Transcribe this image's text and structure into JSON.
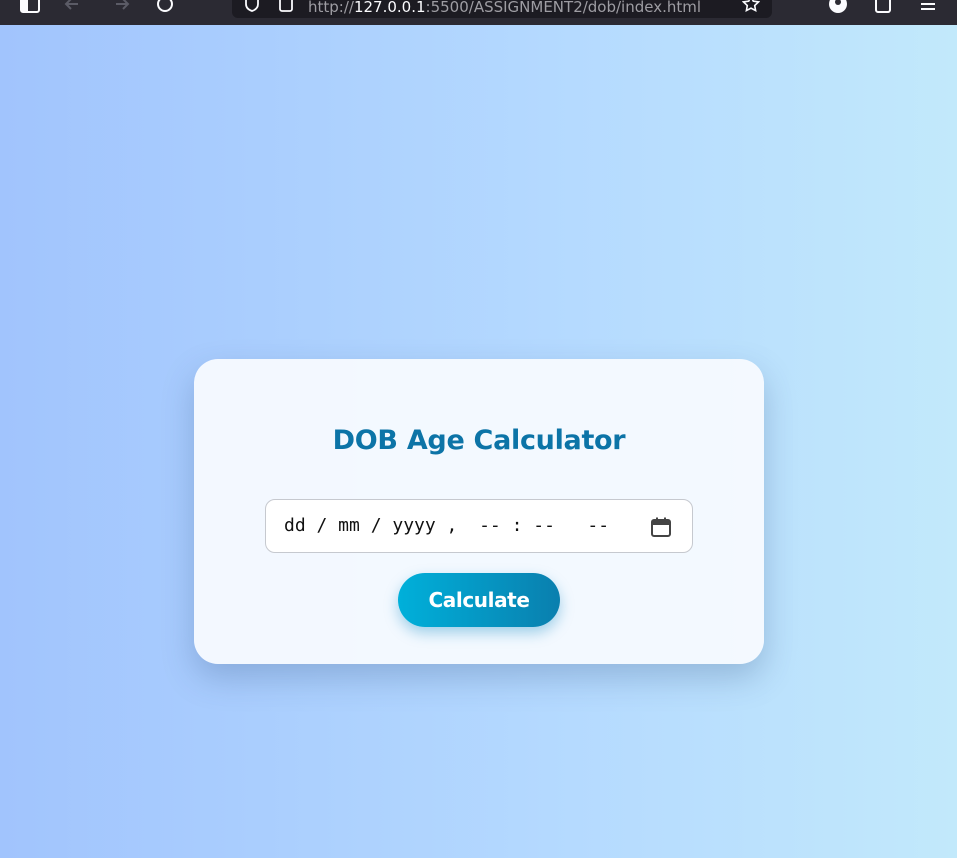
{
  "browser": {
    "url_prefix": "http://",
    "url_host": "127.0.0.1",
    "url_path": ":5500/ASSIGNMENT2/dob/index.html",
    "icons": [
      "sidebar-icon",
      "back-icon",
      "forward-icon",
      "reload-icon",
      "shield-icon",
      "page-icon",
      "star-icon",
      "account-icon",
      "extensions-icon",
      "menu-icon"
    ]
  },
  "page": {
    "title": "DOB Age Calculator",
    "date_input": {
      "placeholder": "dd / mm / yyyy ,  -- : --   --"
    },
    "calculate_label": "Calculate"
  },
  "colors": {
    "accent": "#0c74a7",
    "button_start": "#00b0da",
    "button_end": "#0a7fae",
    "bg_start": "#a1c4fd",
    "bg_end": "#c2e9fb"
  }
}
